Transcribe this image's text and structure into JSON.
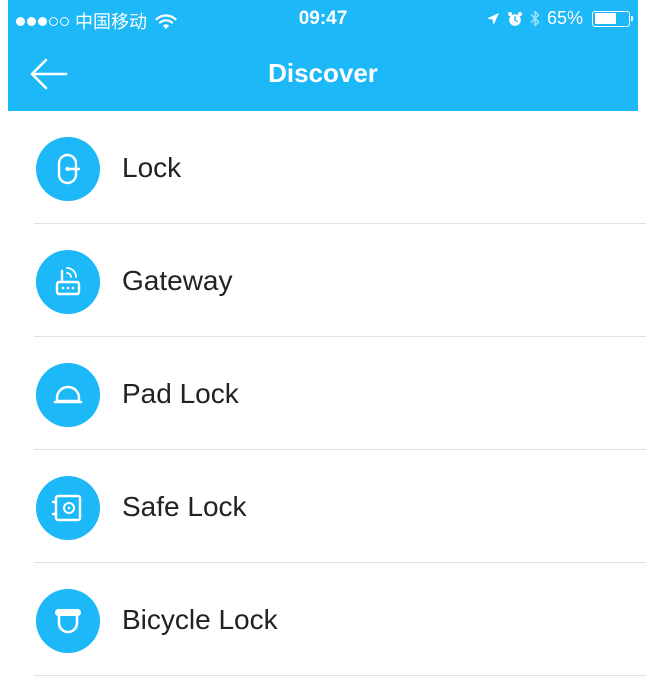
{
  "status_bar": {
    "carrier": "中国移动",
    "time": "09:47",
    "battery": "65%",
    "battery_level": 0.65,
    "icons": [
      "signal-icon",
      "wifi-icon",
      "location-icon",
      "alarm-icon",
      "bluetooth-icon",
      "battery-icon"
    ]
  },
  "header": {
    "title": "Discover",
    "back_icon": "back-arrow-icon"
  },
  "colors": {
    "brand": "#1cb8f8",
    "text": "#222222",
    "divider": "#e1e1e1"
  },
  "items": [
    {
      "label": "Lock",
      "icon": "door-lock-icon"
    },
    {
      "label": "Gateway",
      "icon": "gateway-icon"
    },
    {
      "label": "Pad Lock",
      "icon": "pad-lock-icon"
    },
    {
      "label": "Safe Lock",
      "icon": "safe-lock-icon"
    },
    {
      "label": "Bicycle Lock",
      "icon": "bicycle-lock-icon"
    }
  ]
}
